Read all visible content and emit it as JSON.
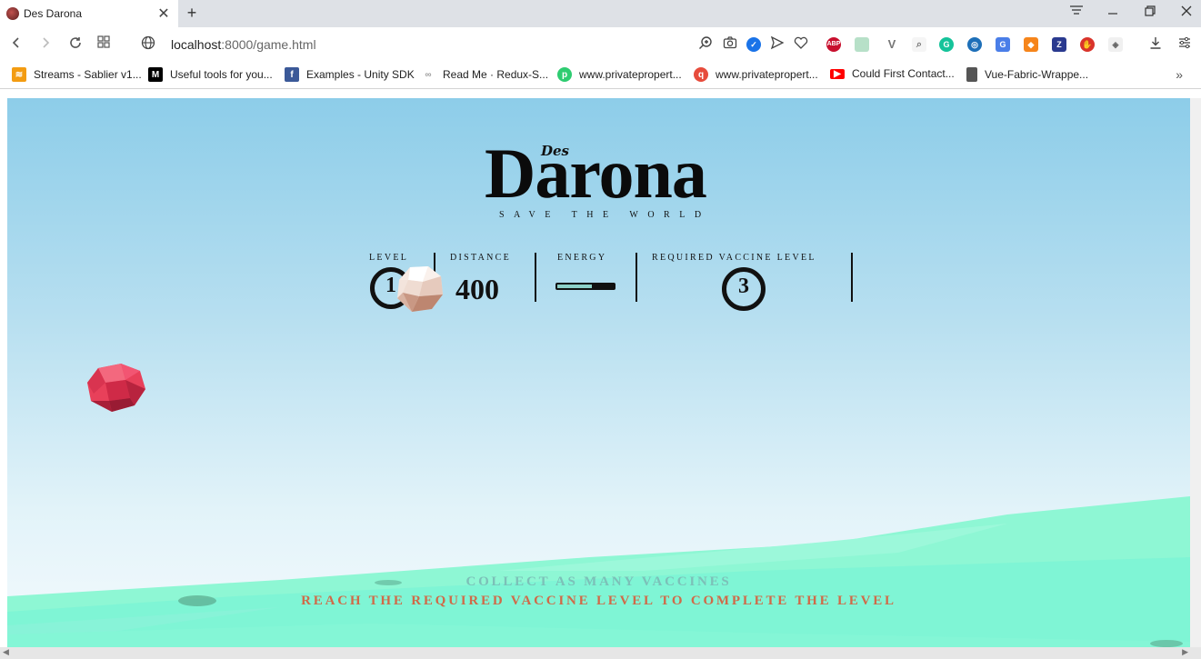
{
  "browser": {
    "tab_title": "Des Darona",
    "url_host": "localhost",
    "url_rest": ":8000/game.html",
    "tab_close": "✕",
    "new_tab": "+",
    "bookmarks": [
      {
        "label": "Streams - Sablier v1...",
        "icon": "sablier-icon",
        "color": "#f39c12"
      },
      {
        "label": "Useful tools for you...",
        "icon": "medium-icon",
        "color": "#000000"
      },
      {
        "label": "Examples - Unity SDK",
        "icon": "facebook-icon",
        "color": "#3b5998"
      },
      {
        "label": "Read Me · Redux-S...",
        "icon": "redux-icon",
        "color": "#9e9e9e"
      },
      {
        "label": "www.privatepropert...",
        "icon": "privateproperty-icon",
        "color": "#2ecc71"
      },
      {
        "label": "www.privatepropert...",
        "icon": "search-pin-icon",
        "color": "#e74c3c"
      },
      {
        "label": "Could First Contact...",
        "icon": "youtube-icon",
        "color": "#ff0000"
      },
      {
        "label": "Vue-Fabric-Wrappe...",
        "icon": "document-icon",
        "color": "#555555"
      }
    ]
  },
  "game": {
    "logo_small": "Des",
    "logo_main": "Darona",
    "logo_tagline": "SAVE THE WORLD",
    "hud": {
      "level_label": "LEVEL",
      "level_value": "1",
      "distance_label": "DISTANCE",
      "distance_value": "400",
      "energy_label": "ENERGY",
      "energy_fraction": 0.62,
      "vaccine_label": "REQUIRED VACCINE LEVEL",
      "vaccine_value": "3"
    },
    "message_line1": "COLLECT AS MANY VACCINES",
    "message_line2": "REACH THE REQUIRED VACCINE LEVEL TO COMPLETE THE LEVEL",
    "colors": {
      "sky_top": "#8dcde9",
      "ground": "#7ff5d5",
      "enemy": "#e8405a",
      "player": "#f3e4dc",
      "message_primary": "#7cc0b8",
      "message_accent": "#d06a48"
    }
  }
}
